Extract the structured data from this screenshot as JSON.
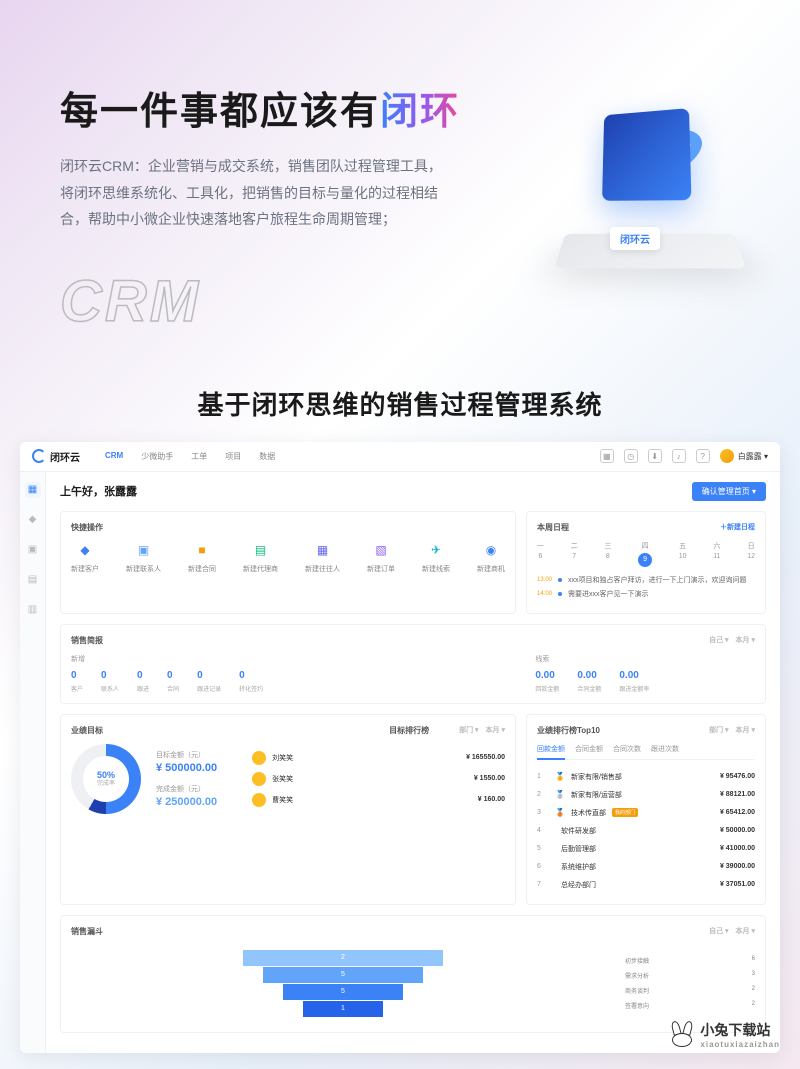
{
  "hero": {
    "title_pre": "每一件事都应该有",
    "title_accent": "闭环",
    "description": "闭环云CRM：企业营销与成交系统，销售团队过程管理工具，将闭环思维系统化、工具化，把销售的目标与量化的过程相结合，帮助中小微企业快速落地客户旅程生命周期管理；",
    "crm_text": "CRM",
    "badge": "闭环云"
  },
  "section_title": "基于闭环思维的销售过程管理系统",
  "dashboard": {
    "brand": "闭环云",
    "nav": [
      "CRM",
      "少微助手",
      "工单",
      "项目",
      "数据"
    ],
    "user": "白露露 ▾",
    "greeting": "上午好，张露露",
    "header_btn": "确认管理首页 ▾",
    "quick_ops_title": "快捷操作",
    "quick_ops": [
      {
        "icon": "◆",
        "label": "新建客户"
      },
      {
        "icon": "▣",
        "label": "新建联系人"
      },
      {
        "icon": "■",
        "label": "新建合同"
      },
      {
        "icon": "▤",
        "label": "新建代理商"
      },
      {
        "icon": "▦",
        "label": "新建往往人"
      },
      {
        "icon": "▧",
        "label": "新建订单"
      },
      {
        "icon": "✈",
        "label": "新建线索"
      },
      {
        "icon": "◉",
        "label": "新建商机"
      }
    ],
    "schedule": {
      "title": "本周日程",
      "add": "＋新建日程",
      "days": [
        {
          "w": "一",
          "d": "6"
        },
        {
          "w": "二",
          "d": "7"
        },
        {
          "w": "三",
          "d": "8"
        },
        {
          "w": "四",
          "d": "9"
        },
        {
          "w": "五",
          "d": "10"
        },
        {
          "w": "六",
          "d": "11"
        },
        {
          "w": "日",
          "d": "12"
        }
      ],
      "items": [
        {
          "time": "13:00",
          "text": "xxx项目和独占客户拜访，进行一下上门演示，欢迎询问题"
        },
        {
          "time": "14:00",
          "text": "需要进xxx客户见一下演示"
        }
      ]
    },
    "brief": {
      "title": "销售简报",
      "filters": "自己 ▾　本月 ▾",
      "sec1": "新增",
      "sec2": "线索",
      "items1": [
        {
          "v": "0",
          "l": "客户"
        },
        {
          "v": "0",
          "l": "联系人"
        },
        {
          "v": "0",
          "l": "跟进"
        },
        {
          "v": "0",
          "l": "合同"
        },
        {
          "v": "0",
          "l": "跟进记录"
        },
        {
          "v": "0",
          "l": "转化签约"
        }
      ],
      "items2": [
        {
          "v": "0.00",
          "l": "回款金额"
        },
        {
          "v": "0.00",
          "l": "合同金额"
        },
        {
          "v": "0.00",
          "l": "跟进金额率"
        }
      ]
    },
    "goal": {
      "title": "业绩目标",
      "rank_title": "目标排行榜",
      "filters": "部门 ▾　本月 ▾",
      "percent": "50%",
      "percent_label": "完成率",
      "target_label": "目标金额（元）",
      "target_value": "¥ 500000.00",
      "done_label": "完成金额（元）",
      "done_value": "¥ 250000.00",
      "ranks": [
        {
          "name": "刘笑笑",
          "amt": "¥ 165550.00"
        },
        {
          "name": "张笑笑",
          "amt": "¥ 1550.00"
        },
        {
          "name": "曹笑笑",
          "amt": "¥ 160.00"
        }
      ]
    },
    "top10": {
      "title": "业绩排行榜Top10",
      "filters": "部门 ▾　本月 ▾",
      "tabs": [
        "回款金额",
        "合同金额",
        "合同次数",
        "跟进次数"
      ],
      "rows": [
        {
          "idx": "1",
          "ico": "🏅",
          "name": "新家有限/销售部",
          "amt": "¥ 95476.00"
        },
        {
          "idx": "2",
          "ico": "🥈",
          "name": "新家有限/运营部",
          "amt": "¥ 88121.00"
        },
        {
          "idx": "3",
          "ico": "🥉",
          "name": "技术传直部",
          "badge": "我的部门",
          "amt": "¥ 65412.00"
        },
        {
          "idx": "4",
          "ico": "",
          "name": "软件研发部",
          "amt": "¥ 50000.00"
        },
        {
          "idx": "5",
          "ico": "",
          "name": "后勤管理部",
          "amt": "¥ 41000.00"
        },
        {
          "idx": "6",
          "ico": "",
          "name": "系统维护部",
          "amt": "¥ 39000.00"
        },
        {
          "idx": "7",
          "ico": "",
          "name": "总经办部门",
          "amt": "¥ 37051.00"
        }
      ]
    },
    "funnel": {
      "title": "销售漏斗",
      "filters": "自己 ▾　本月 ▾",
      "bars": [
        "2",
        "5",
        "5",
        "1"
      ],
      "stats": [
        {
          "l": "初步接触",
          "v": "6"
        },
        {
          "l": "需求分析",
          "v": "3"
        },
        {
          "l": "商务谈判",
          "v": "2"
        },
        {
          "l": "签署意向",
          "v": "2"
        }
      ]
    }
  },
  "watermark": {
    "name": "小兔下载站",
    "sub": "xiaotuxiazaizhan"
  }
}
